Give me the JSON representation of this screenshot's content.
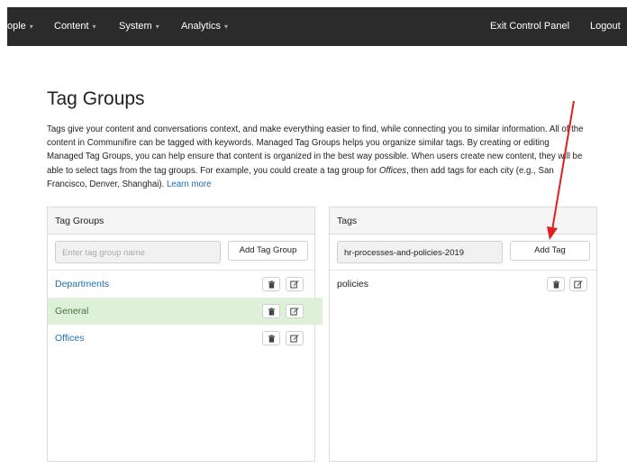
{
  "nav": {
    "items": [
      {
        "label": "ople",
        "caret": "▾"
      },
      {
        "label": "Content",
        "caret": "▾"
      },
      {
        "label": "System",
        "caret": "▾"
      },
      {
        "label": "Analytics",
        "caret": "▾"
      }
    ],
    "exit_label": "Exit Control Panel",
    "logout_label": "Logout"
  },
  "page": {
    "title": "Tag Groups",
    "intro_1": "Tags give your content and conversations context, and make everything easier to find, while connecting you to similar information. All of the content in Communifire can be tagged with keywords. Managed Tag Groups helps you organize similar tags. By creating or editing Managed Tag Groups, you can help ensure that content is organized in the best way possible. When users create new content, they will be able to select tags from the tag groups. For example, you could create a tag group for ",
    "intro_em": "Offices",
    "intro_2": ", then add tags for each city (e.g., San Francisco, Denver, Shanghai). ",
    "learn_more": "Learn more"
  },
  "groups_panel": {
    "title": "Tag Groups",
    "input_placeholder": "Enter tag group name",
    "add_label": "Add Tag Group",
    "items": [
      {
        "label": "Departments",
        "active": false
      },
      {
        "label": "General",
        "active": true
      },
      {
        "label": "Offices",
        "active": false
      }
    ]
  },
  "tags_panel": {
    "title": "Tags",
    "input_value": "hr-processes-and-policies-2019",
    "add_label": "Add Tag",
    "items": [
      {
        "label": "policies"
      }
    ]
  },
  "icons": {
    "delete": "trash-icon",
    "edit": "edit-icon"
  },
  "colors": {
    "nav_bg": "#2b2b2b",
    "link": "#1f6fa8",
    "active_row": "#dff0d8",
    "annotation_arrow": "#e02020"
  }
}
